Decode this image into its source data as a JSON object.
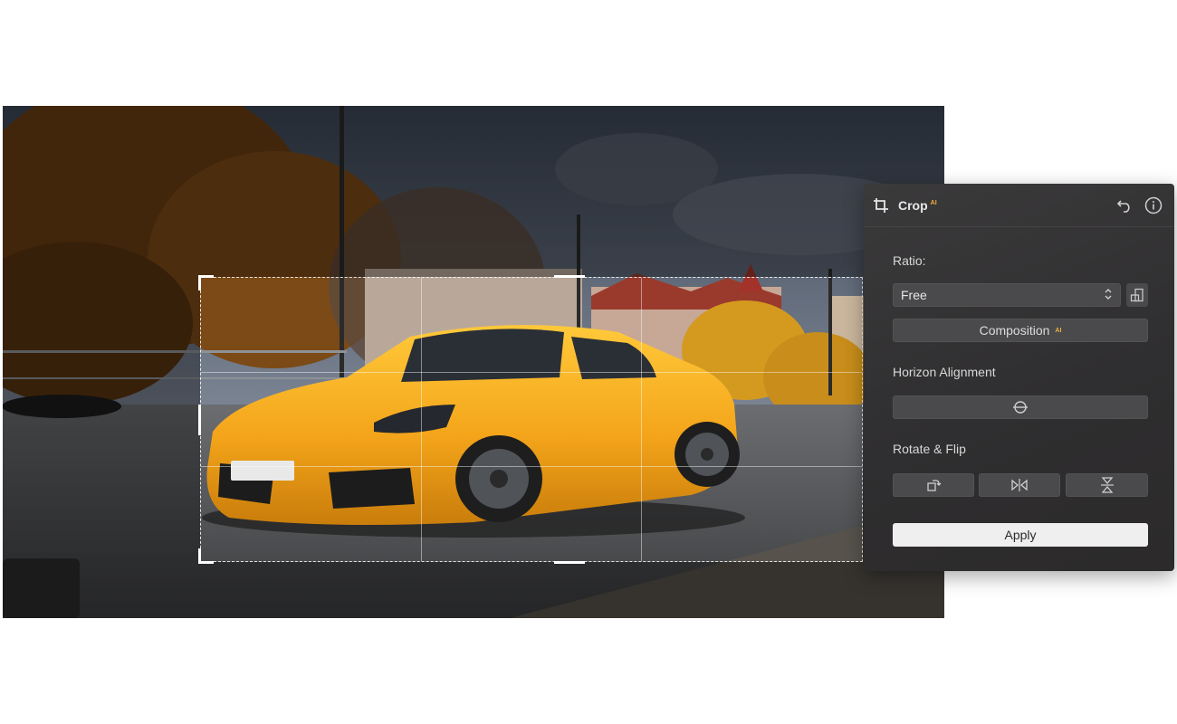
{
  "panel": {
    "title": "Crop",
    "title_badge": "AI",
    "ratio_label": "Ratio:",
    "ratio_value": "Free",
    "composition_label": "Composition",
    "composition_badge": "AI",
    "horizon_label": "Horizon Alignment",
    "rotate_flip_label": "Rotate & Flip",
    "apply_label": "Apply"
  },
  "icons": {
    "crop": "crop-icon",
    "undo": "undo-icon",
    "info": "info-icon",
    "ratio_swap": "orientation-swap-icon",
    "chevron": "chevron-up-down-icon",
    "horizon": "horizon-level-icon",
    "rotate": "rotate-icon",
    "flip_h": "flip-horizontal-icon",
    "flip_v": "flip-vertical-icon"
  },
  "colors": {
    "panel_bg": "#333234",
    "control_bg": "#4a494b",
    "apply_bg": "#efefef",
    "ai_badge": "#f0b040",
    "car": "#f2a81c"
  }
}
